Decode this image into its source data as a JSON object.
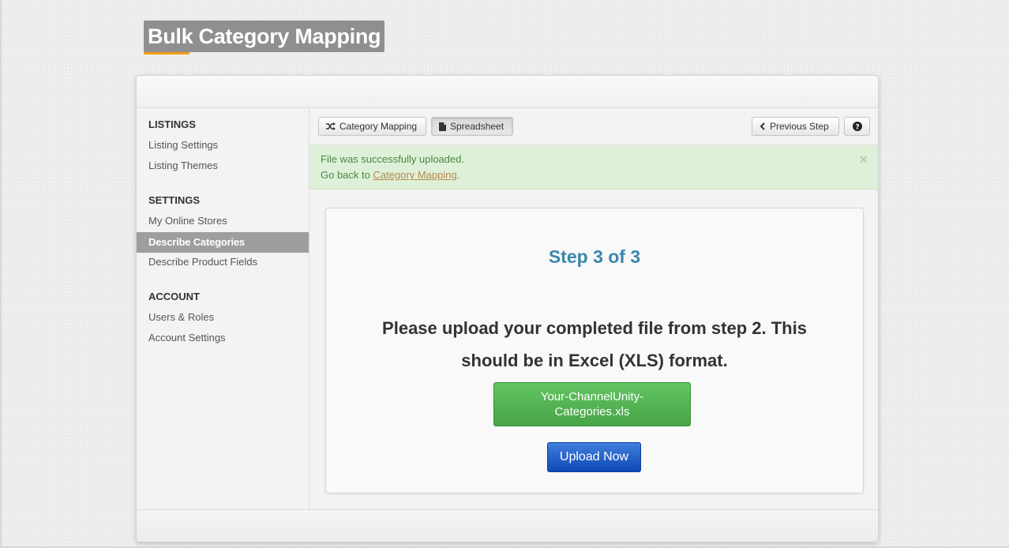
{
  "page": {
    "title": "Bulk Category Mapping"
  },
  "sidebar": {
    "sections": [
      {
        "heading": "LISTINGS",
        "items": [
          "Listing Settings",
          "Listing Themes"
        ]
      },
      {
        "heading": "SETTINGS",
        "items": [
          "My Online Stores",
          "Describe Categories",
          "Describe Product Fields"
        ]
      },
      {
        "heading": "ACCOUNT",
        "items": [
          "Users & Roles",
          "Account Settings"
        ]
      }
    ],
    "active_item": "Describe Categories"
  },
  "toolbar": {
    "category_mapping_label": "Category Mapping",
    "spreadsheet_label": "Spreadsheet",
    "previous_step_label": "Previous Step"
  },
  "alert": {
    "line1": "File was successfully uploaded.",
    "line2_prefix": "Go back to ",
    "line2_link": "Category Mapping",
    "line2_suffix": ".",
    "close": "×"
  },
  "step": {
    "title": "Step 3 of 3",
    "instruction_line1": "Please upload your completed file from step 2. This",
    "instruction_line2": "should be in Excel (XLS) format.",
    "file_button_label": "Your-ChannelUnity-Categories.xls",
    "upload_button_label": "Upload Now"
  },
  "colors": {
    "title_bg": "#8f8f8f",
    "title_underline": "#f39c12",
    "step_title": "#3a87ad",
    "alert_bg": "#dff0d8",
    "alert_text": "#468847",
    "file_button": "#5cb85c",
    "upload_button": "#1d5fcc",
    "sidebar_active": "#9e9e9e"
  },
  "icons": {
    "category_mapping": "shuffle-icon",
    "spreadsheet": "file-icon",
    "previous_step": "chevron-left-icon",
    "help": "question-circle-icon"
  }
}
